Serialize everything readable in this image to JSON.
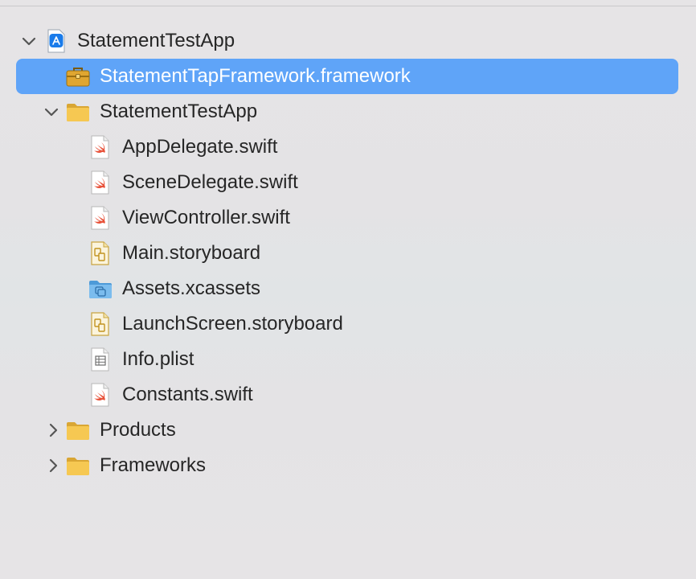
{
  "navigator": {
    "project": {
      "label": "StatementTestApp",
      "icon": "app-project-icon",
      "expanded": true
    },
    "items": [
      {
        "id": "framework",
        "label": "StatementTapFramework.framework",
        "icon": "framework-toolbox-icon",
        "selected": true
      },
      {
        "id": "group-app",
        "label": "StatementTestApp",
        "icon": "folder-icon",
        "expanded": true
      },
      {
        "id": "appdelegate",
        "label": "AppDelegate.swift",
        "icon": "swift-file-icon"
      },
      {
        "id": "scenedelegate",
        "label": "SceneDelegate.swift",
        "icon": "swift-file-icon"
      },
      {
        "id": "viewcontroller",
        "label": "ViewController.swift",
        "icon": "swift-file-icon"
      },
      {
        "id": "mainstoryboard",
        "label": "Main.storyboard",
        "icon": "storyboard-file-icon"
      },
      {
        "id": "assets",
        "label": "Assets.xcassets",
        "icon": "asset-catalog-icon"
      },
      {
        "id": "launchscreen",
        "label": "LaunchScreen.storyboard",
        "icon": "storyboard-file-icon"
      },
      {
        "id": "infoplist",
        "label": "Info.plist",
        "icon": "plist-file-icon"
      },
      {
        "id": "constants",
        "label": "Constants.swift",
        "icon": "swift-file-icon"
      },
      {
        "id": "group-products",
        "label": "Products",
        "icon": "folder-icon",
        "expanded": false
      },
      {
        "id": "group-frameworks",
        "label": "Frameworks",
        "icon": "folder-icon",
        "expanded": false
      }
    ]
  },
  "colors": {
    "selection": "#5fa4f8",
    "folder": "#f4c24f",
    "swift": "#e8523a",
    "text": "#262626"
  }
}
